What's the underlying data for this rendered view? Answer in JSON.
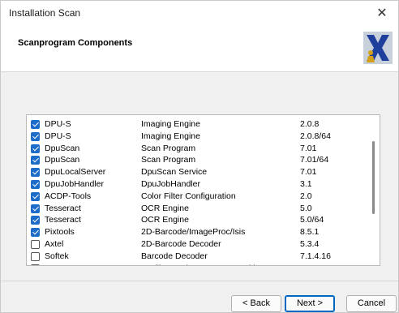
{
  "window": {
    "title": "Installation Scan",
    "close_glyph": "✕"
  },
  "header": {
    "title": "Scanprogram Components",
    "logo_icon": "x-logo-icon",
    "logo_colors": {
      "x": "#1f3f9c",
      "figure": "#d4a017",
      "bg": "#c8d0dc"
    }
  },
  "components": [
    {
      "checked": true,
      "name": "DPU-S",
      "description": "Imaging Engine",
      "version": "2.0.8"
    },
    {
      "checked": true,
      "name": "DPU-S",
      "description": "Imaging Engine",
      "version": "2.0.8/64"
    },
    {
      "checked": true,
      "name": "DpuScan",
      "description": "Scan Program",
      "version": "7.01"
    },
    {
      "checked": true,
      "name": "DpuScan",
      "description": "Scan Program",
      "version": "7.01/64"
    },
    {
      "checked": true,
      "name": "DpuLocalServer",
      "description": "DpuScan Service",
      "version": "7.01"
    },
    {
      "checked": true,
      "name": "DpuJobHandler",
      "description": "DpuJobHandler",
      "version": "3.1"
    },
    {
      "checked": true,
      "name": "ACDP-Tools",
      "description": "Color Filter Configuration",
      "version": "2.0"
    },
    {
      "checked": true,
      "name": "Tesseract",
      "description": "OCR Engine",
      "version": "5.0"
    },
    {
      "checked": true,
      "name": "Tesseract",
      "description": "OCR Engine",
      "version": "5.0/64"
    },
    {
      "checked": true,
      "name": "Pixtools",
      "description": "2D-Barcode/ImageProc/Isis",
      "version": "8.5.1"
    },
    {
      "checked": false,
      "name": "Axtel",
      "description": "2D-Barcode Decoder",
      "version": "5.3.4"
    },
    {
      "checked": false,
      "name": "Softek",
      "description": "Barcode Decoder",
      "version": "7.1.4.16"
    },
    {
      "checked": false,
      "name": "I.R.I.S",
      "description": "Intelligent Character Recognition",
      "version": ""
    }
  ],
  "buttons": {
    "back": "< Back",
    "next": "Next >",
    "cancel": "Cancel"
  },
  "colors": {
    "checkbox_accent": "#1c6cc8",
    "default_button_border": "#0067c0"
  }
}
